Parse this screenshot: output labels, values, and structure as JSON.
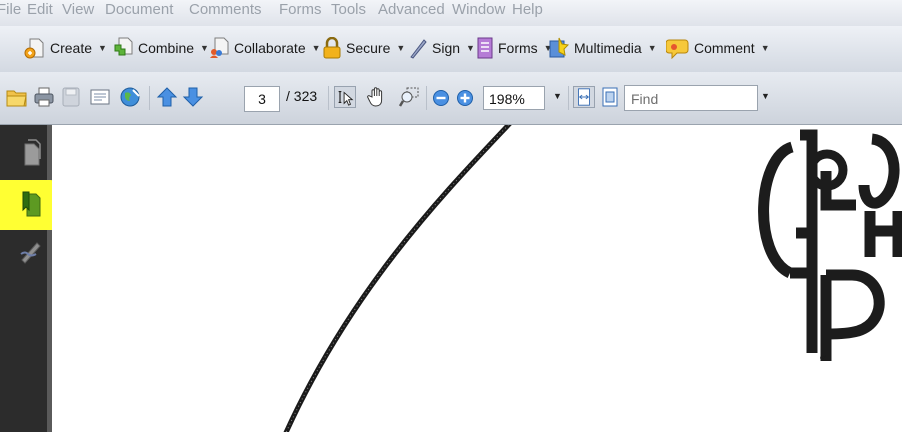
{
  "menu": [
    "File",
    "Edit",
    "View",
    "Document",
    "Comments",
    "Forms",
    "Tools",
    "Advanced",
    "Window",
    "Help"
  ],
  "task_toolbar": {
    "create": "Create",
    "combine": "Combine",
    "collaborate": "Collaborate",
    "secure": "Secure",
    "sign": "Sign",
    "forms": "Forms",
    "multimedia": "Multimedia",
    "comment": "Comment"
  },
  "nav_toolbar": {
    "page_current": "3",
    "page_total": "/ 323",
    "zoom": "198%",
    "find_placeholder": "Find"
  },
  "colors": {
    "highlight": "#ffff33",
    "arrow": "#1a1ad6",
    "nav_pane": "#2c2c2c"
  },
  "icons": {
    "nav_pane": [
      "pages-icon",
      "bookmarks-icon",
      "signatures-icon"
    ]
  }
}
